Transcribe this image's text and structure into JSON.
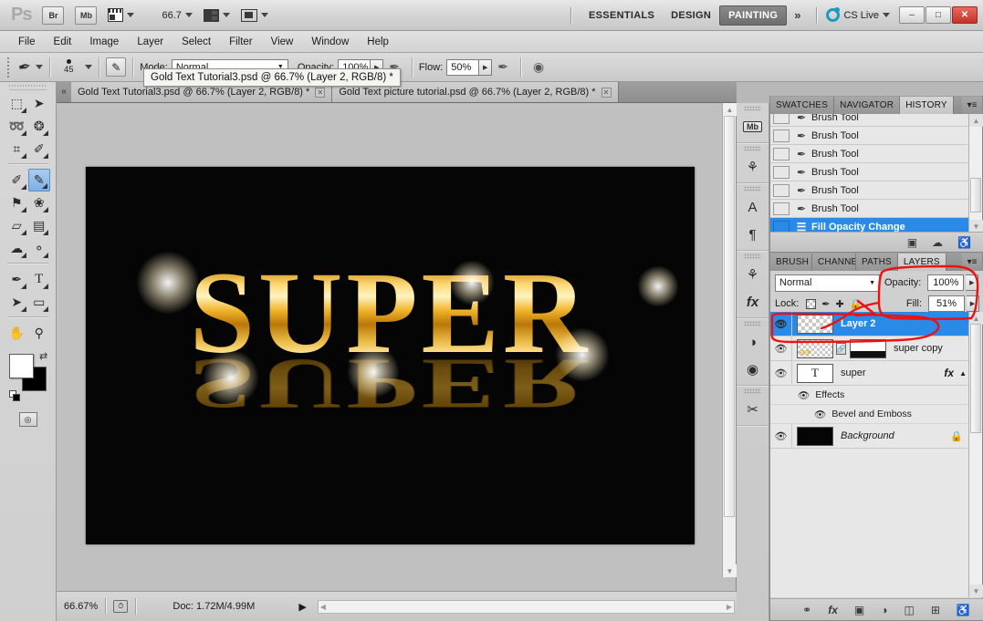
{
  "app": {
    "logo": "Ps",
    "bridge_label": "Br",
    "minibridge_label": "Mb",
    "zoom_level": "66.7",
    "workspaces": [
      {
        "label": "ESSENTIALS",
        "active": false
      },
      {
        "label": "DESIGN",
        "active": false
      },
      {
        "label": "PAINTING",
        "active": true
      }
    ],
    "more_workspaces": "»",
    "cs_live": "CS Live",
    "window_buttons": {
      "minimize": "–",
      "maximize": "□",
      "close": "✕"
    }
  },
  "menu": {
    "items": [
      "File",
      "Edit",
      "Image",
      "Layer",
      "Select",
      "Filter",
      "View",
      "Window",
      "Help"
    ]
  },
  "options_bar": {
    "brush_size": "45",
    "mode_label": "Mode:",
    "mode_value": "Normal",
    "opacity_label": "Opacity:",
    "opacity_value": "100%",
    "flow_label": "Flow:",
    "flow_value": "50%"
  },
  "tooltip": {
    "text": "Gold Text Tutorial3.psd @ 66.7% (Layer 2, RGB/8) *"
  },
  "document_tabs": [
    {
      "label": "Gold Text Tutorial3.psd @ 66.7% (Layer 2, RGB/8) *",
      "active": true,
      "close": "✕"
    },
    {
      "label": "Gold Text picture tutorial.psd @  66.7% (Layer 2, RGB/8) *",
      "active": false,
      "close": "✕"
    }
  ],
  "toolbox": {
    "tools": [
      {
        "name": "marquee-tool",
        "glyph": "⬚",
        "selected": false
      },
      {
        "name": "move-tool",
        "glyph": "➤",
        "selected": false
      },
      {
        "name": "lasso-tool",
        "glyph": "➿",
        "selected": false
      },
      {
        "name": "quick-selection-tool",
        "glyph": "❂",
        "selected": false
      },
      {
        "name": "crop-tool",
        "glyph": "⌗",
        "selected": false
      },
      {
        "name": "eyedropper-tool",
        "glyph": "✐",
        "selected": false
      },
      {
        "name": "healing-brush-tool",
        "glyph": "✐",
        "selected": false
      },
      {
        "name": "brush-tool",
        "glyph": "✎",
        "selected": true
      },
      {
        "name": "clone-stamp-tool",
        "glyph": "⚑",
        "selected": false
      },
      {
        "name": "history-brush-tool",
        "glyph": "❀",
        "selected": false
      },
      {
        "name": "eraser-tool",
        "glyph": "▱",
        "selected": false
      },
      {
        "name": "gradient-tool",
        "glyph": "▤",
        "selected": false
      },
      {
        "name": "blur-tool",
        "glyph": "☁",
        "selected": false
      },
      {
        "name": "dodge-tool",
        "glyph": "⚬",
        "selected": false
      },
      {
        "name": "pen-tool",
        "glyph": "✒",
        "selected": false
      },
      {
        "name": "type-tool",
        "glyph": "T",
        "selected": false
      },
      {
        "name": "path-selection-tool",
        "glyph": "➤",
        "selected": false
      },
      {
        "name": "rectangle-tool",
        "glyph": "▭",
        "selected": false
      },
      {
        "name": "hand-tool",
        "glyph": "✋",
        "selected": false
      },
      {
        "name": "zoom-tool",
        "glyph": "⚲",
        "selected": false
      }
    ],
    "foreground_color": "#ffffff",
    "background_color": "#000000",
    "swap_glyph": "⇄"
  },
  "canvas": {
    "artwork_text": "SUPER",
    "background_color": "#050505",
    "gold_color": "#ffd978"
  },
  "status_bar": {
    "zoom": "66.67%",
    "doc_info": "Doc: 1.72M/4.99M",
    "expand_arrow": "▶"
  },
  "dock_strip": {
    "icons": [
      {
        "name": "mini-bridge-icon",
        "glyph": "Mb"
      },
      {
        "name": "brush-presets-icon",
        "glyph": "⚘"
      },
      {
        "name": "character-panel-icon",
        "glyph": "A"
      },
      {
        "name": "paragraph-panel-icon",
        "glyph": "¶"
      },
      {
        "name": "color-panel-icon",
        "glyph": "⚘"
      },
      {
        "name": "styles-panel-icon",
        "glyph": "fx"
      },
      {
        "name": "adjustments-panel-icon",
        "glyph": "◑"
      },
      {
        "name": "masks-panel-icon",
        "glyph": "◉"
      },
      {
        "name": "tools-panel-icon",
        "glyph": "✂"
      }
    ]
  },
  "history_panel": {
    "tabs": [
      {
        "label": "SWATCHES",
        "active": false
      },
      {
        "label": "NAVIGATOR",
        "active": false
      },
      {
        "label": "HISTORY",
        "active": true
      }
    ],
    "menu_glyph": "▾≡",
    "states": [
      {
        "label": "Brush Tool",
        "selected": false
      },
      {
        "label": "Brush Tool",
        "selected": false
      },
      {
        "label": "Brush Tool",
        "selected": false
      },
      {
        "label": "Brush Tool",
        "selected": false
      },
      {
        "label": "Brush Tool",
        "selected": false
      },
      {
        "label": "Brush Tool",
        "selected": false
      },
      {
        "label": "Fill Opacity Change",
        "selected": true
      }
    ],
    "footer_icons": [
      {
        "name": "new-document-from-state-icon",
        "glyph": "▣"
      },
      {
        "name": "new-snapshot-icon",
        "glyph": "὏7"
      },
      {
        "name": "delete-state-icon",
        "glyph": "Ὕ1"
      }
    ],
    "scroll_up": "▲",
    "scroll_down": "▼"
  },
  "layers_panel": {
    "tabs": [
      {
        "label": "BRUSH P",
        "active": false
      },
      {
        "label": "CHANNE",
        "active": false
      },
      {
        "label": "PATHS",
        "active": false
      },
      {
        "label": "LAYERS",
        "active": true
      }
    ],
    "menu_glyph": "▾≡",
    "blend_mode": "Normal",
    "opacity_label": "Opacity:",
    "opacity_value": "100%",
    "lock_label": "Lock:",
    "fill_label": "Fill:",
    "fill_value": "51%",
    "layers": [
      {
        "name": "Layer 2",
        "selected": true,
        "thumb": "checker",
        "visible": true,
        "italic": false
      },
      {
        "name": "super copy",
        "selected": false,
        "thumb": "gold-masked",
        "visible": true,
        "italic": false
      },
      {
        "name": "super",
        "selected": false,
        "thumb": "type",
        "visible": true,
        "italic": false,
        "fx": "fx",
        "sub": [
          {
            "label": "Effects",
            "indent": 1
          },
          {
            "label": "Bevel and Emboss",
            "indent": 2
          }
        ]
      },
      {
        "name": "Background",
        "selected": false,
        "thumb": "black",
        "visible": true,
        "italic": true,
        "locked": "ὑ2"
      }
    ],
    "footer_icons": [
      {
        "name": "link-layers-icon",
        "glyph": "⚭"
      },
      {
        "name": "layer-style-icon",
        "glyph": "fx"
      },
      {
        "name": "add-layer-mask-icon",
        "glyph": "□"
      },
      {
        "name": "new-fill-adjustment-icon",
        "glyph": "◑"
      },
      {
        "name": "new-group-icon",
        "glyph": "▱"
      },
      {
        "name": "new-layer-icon",
        "glyph": "⬒"
      },
      {
        "name": "delete-layer-icon",
        "glyph": "Ὕ1"
      }
    ]
  },
  "annotations": {
    "color": "#ee1111",
    "note": "hand-drawn red circles highlighting Fill value and Layer 2 row"
  }
}
